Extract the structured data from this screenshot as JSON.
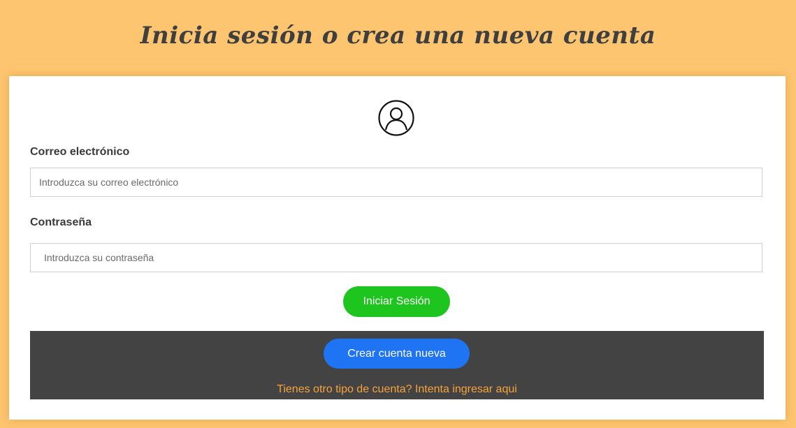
{
  "header": {
    "title": "Inicia sesión o crea una nueva cuenta"
  },
  "form": {
    "email_label": "Correo electrónico",
    "email_placeholder": "Introduzca su correo electrónico",
    "email_value": "",
    "password_label": "Contraseña",
    "password_placeholder": "Introduzca su contraseña",
    "password_value": "",
    "login_button": "Iniciar Sesión"
  },
  "footer": {
    "create_button": "Crear cuenta nueva",
    "alt_link": "Tienes otro tipo de cuenta? Intenta ingresar aqui"
  },
  "colors": {
    "background": "#fec570",
    "login": "#1ec51e",
    "create": "#1f74f3",
    "link": "#f5a33c",
    "panel": "#434343"
  }
}
